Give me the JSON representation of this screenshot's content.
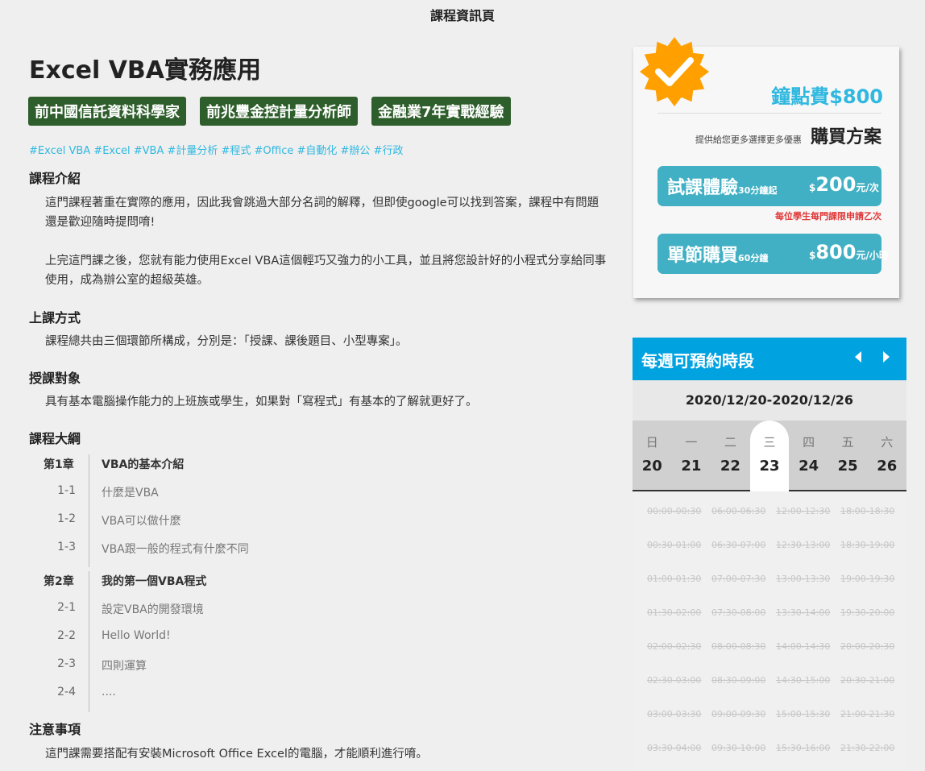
{
  "page_title": "課程資訊頁",
  "course": {
    "title": "Excel VBA實務應用",
    "badges": [
      "前中國信託資料科學家",
      "前兆豐金控計量分析師",
      "金融業7年實戰經驗"
    ],
    "tags": "#Excel VBA #Excel #VBA #計量分析 #程式 #Office #自動化 #辦公 #行政"
  },
  "sections": {
    "intro_title": "課程介紹",
    "intro_p1": "這門課程著重在實際的應用，因此我會跳過大部分名詞的解釋，但即使google可以找到答案，課程中有問題還是歡迎隨時提問唷!",
    "intro_p2": "上完這門課之後，您就有能力使用Excel VBA這個輕巧又強力的小工具，並且將您設計好的小程式分享給同事使用，成為辦公室的超級英雄。",
    "method_title": "上課方式",
    "method_text": "課程總共由三個環節所構成，分別是：「授課、課後題目、小型專案」。",
    "audience_title": "授課對象",
    "audience_text": "具有基本電腦操作能力的上班族或學生，如果對「寫程式」有基本的了解就更好了。",
    "outline_title": "課程大綱",
    "notes_title": "注意事項",
    "notes_text": "這門課需要搭配有安裝Microsoft Office Excel的電腦，才能順利進行唷。"
  },
  "outline": [
    {
      "chapter": "第1章",
      "title": "VBA的基本介紹",
      "lessons": [
        {
          "num": "1-1",
          "title": "什麼是VBA"
        },
        {
          "num": "1-2",
          "title": "VBA可以做什麼"
        },
        {
          "num": "1-3",
          "title": "VBA跟一般的程式有什麼不同"
        }
      ]
    },
    {
      "chapter": "第2章",
      "title": "我的第一個VBA程式",
      "lessons": [
        {
          "num": "2-1",
          "title": "設定VBA的開發環境"
        },
        {
          "num": "2-2",
          "title": "Hello World!"
        },
        {
          "num": "2-3",
          "title": "四則運算"
        },
        {
          "num": "2-4",
          "title": "...."
        }
      ]
    }
  ],
  "pricing": {
    "point_fee": "鐘點費$800",
    "plan_subtitle": "提供給您更多選擇更多優惠",
    "plan_title": "購買方案",
    "trial": {
      "name": "試課體驗",
      "detail": "30分鐘起",
      "currency": "$",
      "price": "200",
      "unit": "元/次"
    },
    "trial_note": "每位學生每門課限申請乙次",
    "single": {
      "name": "單節購買",
      "detail": "60分鐘",
      "currency": "$",
      "price": "800",
      "unit": "元/小時"
    },
    "accent_color": "#2fb8e0",
    "button_color": "#41b0c4",
    "badge_color": "#ffa000"
  },
  "booking": {
    "title": "每週可預約時段",
    "range": "2020/12/20-2020/12/26",
    "header_color": "#00a2e0",
    "days": [
      {
        "weekday": "日",
        "date": "20",
        "selected": false
      },
      {
        "weekday": "一",
        "date": "21",
        "selected": false
      },
      {
        "weekday": "二",
        "date": "22",
        "selected": false
      },
      {
        "weekday": "三",
        "date": "23",
        "selected": true
      },
      {
        "weekday": "四",
        "date": "24",
        "selected": false
      },
      {
        "weekday": "五",
        "date": "25",
        "selected": false
      },
      {
        "weekday": "六",
        "date": "26",
        "selected": false
      }
    ],
    "slot_rows": [
      [
        "00:00-00:30",
        "06:00-06:30",
        "12:00-12:30",
        "18:00-18:30"
      ],
      [
        "00:30-01:00",
        "06:30-07:00",
        "12:30-13:00",
        "18:30-19:00"
      ],
      [
        "01:00-01:30",
        "07:00-07:30",
        "13:00-13:30",
        "19:00-19:30"
      ],
      [
        "01:30-02:00",
        "07:30-08:00",
        "13:30-14:00",
        "19:30-20:00"
      ],
      [
        "02:00-02:30",
        "08:00-08:30",
        "14:00-14:30",
        "20:00-20:30"
      ],
      [
        "02:30-03:00",
        "08:30-09:00",
        "14:30-15:00",
        "20:30-21:00"
      ],
      [
        "03:00-03:30",
        "09:00-09:30",
        "15:00-15:30",
        "21:00-21:30"
      ],
      [
        "03:30-04:00",
        "09:30-10:00",
        "15:30-16:00",
        "21:30-22:00"
      ]
    ]
  }
}
